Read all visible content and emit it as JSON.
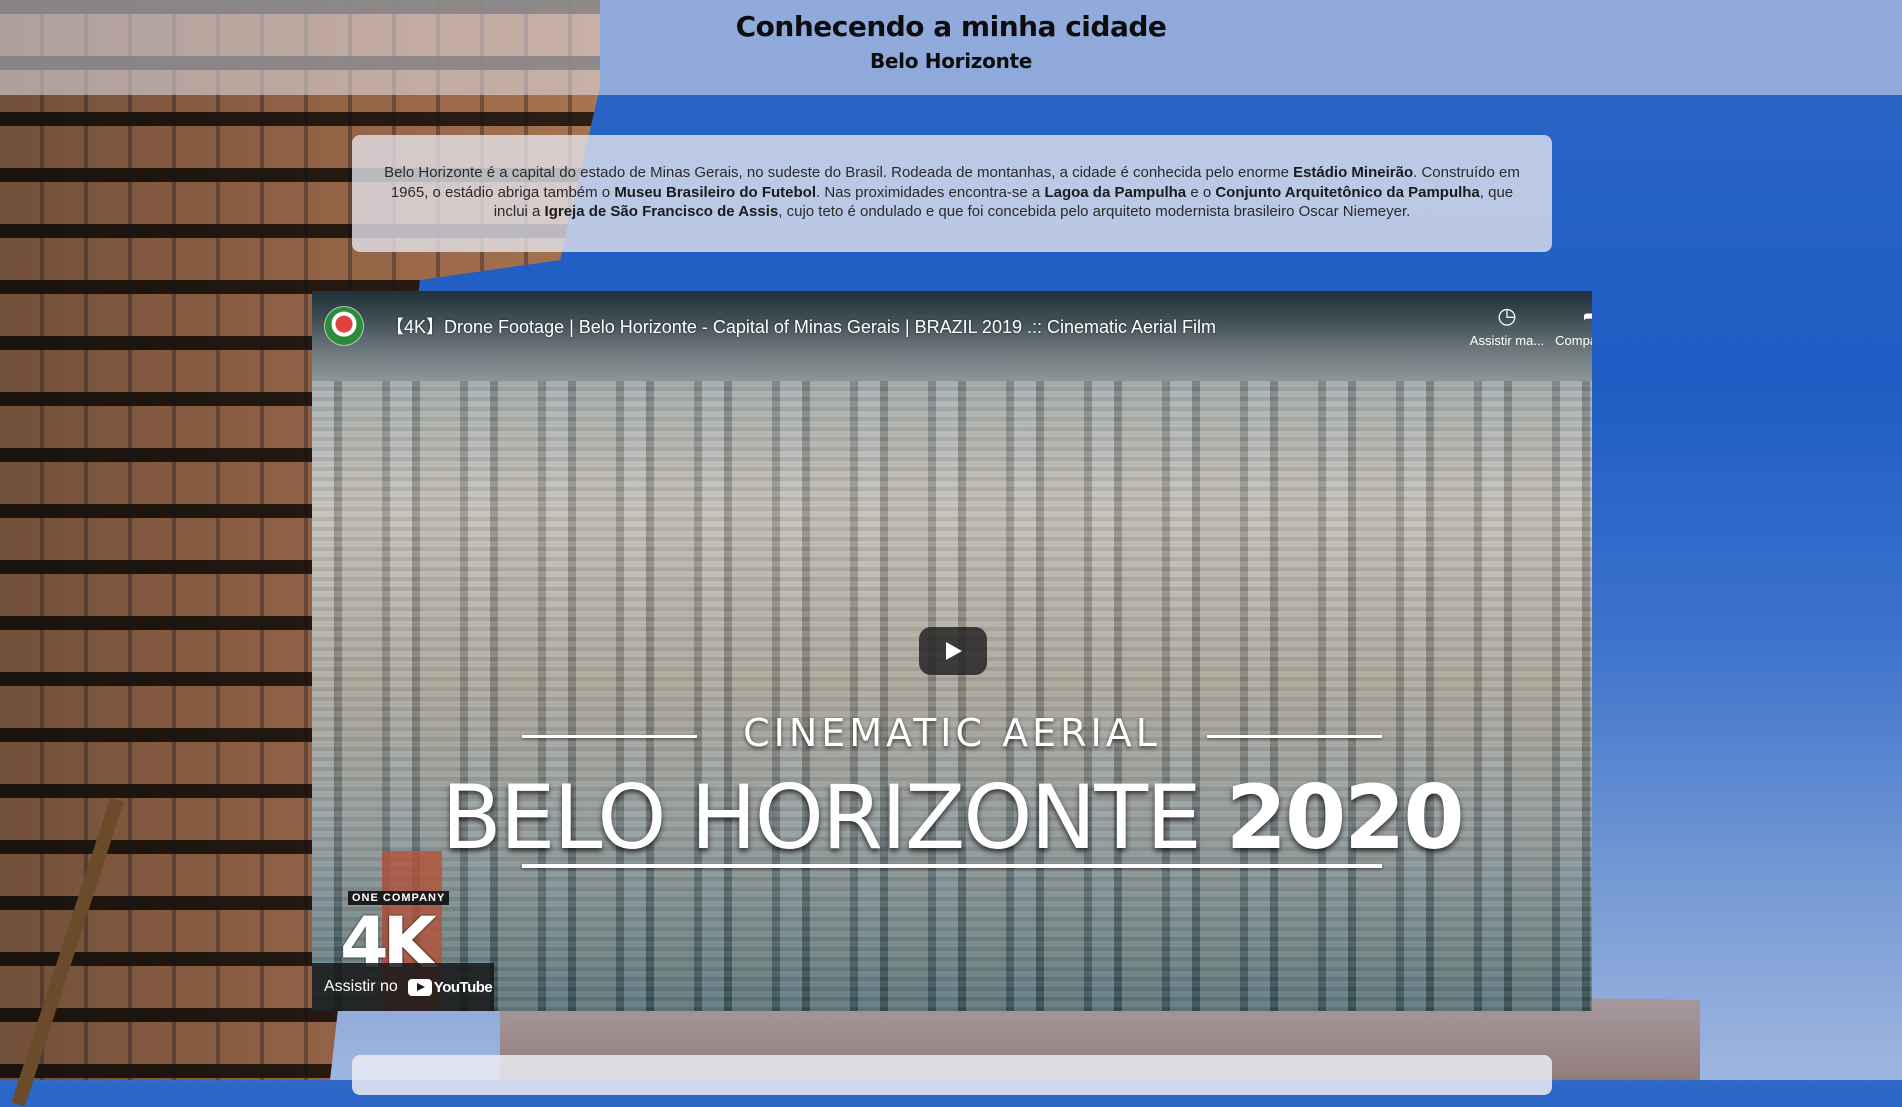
{
  "header": {
    "title": "Conhecendo a minha cidade",
    "subtitle": "Belo Horizonte"
  },
  "description": {
    "p1_a": "Belo Horizonte é a capital do estado de Minas Gerais, no sudeste do Brasil. Rodeada de montanhas, a cidade é conhecida pelo enorme ",
    "p1_b": "Estádio Mineirão",
    "p1_c": ". Construído em 1965, o estádio abriga também o ",
    "p1_d": "Museu Brasileiro do Futebol",
    "p1_e": ". Nas proximidades encontra-se a ",
    "p1_f": "Lagoa da Pampulha",
    "p1_g": " e o ",
    "p1_h": "Conjunto Arquitetônico da Pampulha",
    "p1_i": ", que inclui a ",
    "p1_j": "Igreja de São Francisco de Assis",
    "p1_k": ", cujo teto é ondulado e que foi concebida pelo arquiteto modernista brasileiro Oscar Niemeyer."
  },
  "video": {
    "title": "【4K】Drone Footage | Belo Horizonte - Capital of Minas Gerais | BRAZIL 2019 .:: Cinematic Aerial Film",
    "watch_later_label": "Assistir ma...",
    "watch_later_icon": "clock-icon",
    "share_label": "Compartilh...",
    "share_icon": "share-icon",
    "overlay_line1": "Cinematic Aerial",
    "overlay_line2_a": "Belo Horizonte",
    "overlay_line2_b": "2020",
    "brand_tag": "ONE COMPANY",
    "brand_mark": "4K",
    "watch_on_label": "Assistir no",
    "youtube_label": "YouTube"
  },
  "colors": {
    "accent_blue": "#1e5cc4",
    "header_bg": "#e1e1eb",
    "card_bg": "#e6e6ee"
  }
}
